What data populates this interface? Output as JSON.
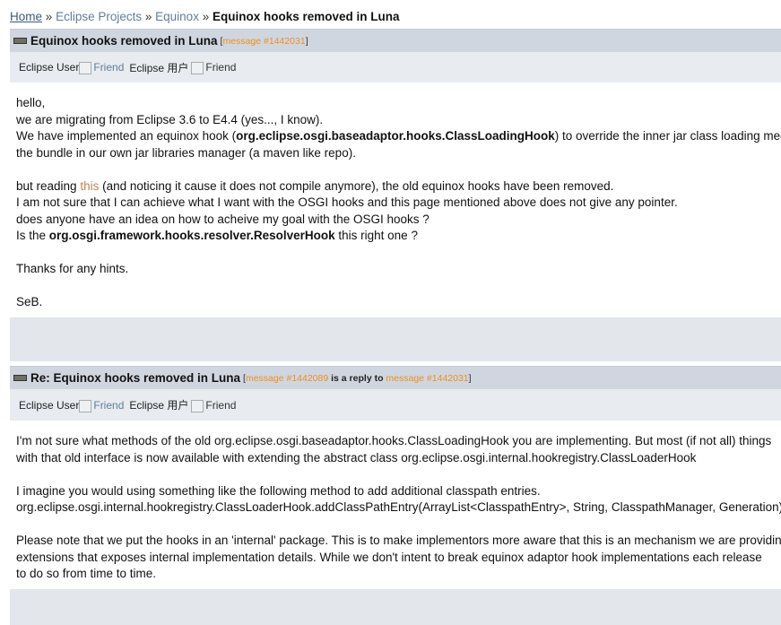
{
  "breadcrumb": {
    "home": "Home",
    "sep": "»",
    "projects": "Eclipse Projects",
    "equinox": "Equinox",
    "current": "Equinox hooks removed in Luna"
  },
  "post1": {
    "title": "Equinox hooks removed in Luna",
    "msg_link": "message #1442031",
    "author1": "Eclipse User",
    "friend": "Friend",
    "author2": "Eclipse 用户",
    "l1": "hello,",
    "l2": "we are migrating from Eclipse 3.6 to E4.4 (yes..., I know).",
    "l3a": "We have implemented an equinox hook (",
    "l3b": "org.eclipse.osgi.baseadaptor.hooks.ClassLoadingHook",
    "l3c": ") to override the inner jar class loading mechanism",
    "l4": "the bundle in our own jar libraries manager (a maven like repo).",
    "l5a": "but reading ",
    "l5link": "this",
    "l5b": " (and noticing it cause it does not compile anymore), the old equinox hooks have been removed.",
    "l6": "I am not sure that I can achieve what I want with the OSGI hooks and this page mentioned above does not give any pointer.",
    "l7": "does anyone have an idea on how to acheive my goal with the OSGI hooks ?",
    "l8a": "Is the ",
    "l8b": "org.osgi.framework.hooks.resolver.ResolverHook",
    "l8c": " this right one ?",
    "l9": "Thanks for any hints.",
    "l10": "SeB."
  },
  "post2": {
    "title": "Re: Equinox hooks removed in Luna",
    "msg_link": "message #1442089",
    "reply_text": "is a reply to",
    "reply_link": "message #1442031",
    "author1": "Eclipse User",
    "friend": "Friend",
    "author2": "Eclipse 用户",
    "l1": "I'm not sure what methods of the old org.eclipse.osgi.baseadaptor.hooks.ClassLoadingHook you are implementing. But most (if not all) things",
    "l2": "with that old interface is now available with extending the abstract class org.eclipse.osgi.internal.hookregistry.ClassLoaderHook",
    "l3": "I imagine you would using something like the following method to add additional classpath entries.",
    "l4": "org.eclipse.osgi.internal.hookregistry.ClassLoaderHook.addClassPathEntry(ArrayList<ClasspathEntry>, String, ClasspathManager, Generation)",
    "l5": "Please note that we put the hooks in an 'internal' package. This is to make implementors more aware that this is an mechanism we are providing",
    "l6": "extensions that exposes internal implementation details. While we don't intent to break equinox adaptor hook implementations each release",
    "l7": "to do so from time to time."
  }
}
